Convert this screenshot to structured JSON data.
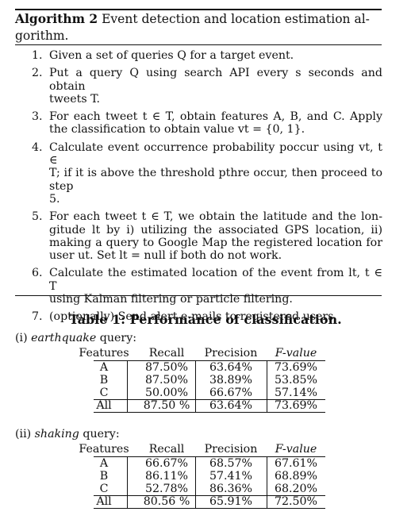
{
  "algorithm": {
    "label": "Algorithm 2",
    "title_line1": "Event detection and location estimation al-",
    "title_line2": "gorithm.",
    "steps": [
      {
        "num": "1.",
        "lines": [
          "Given a set of queries Q for a target event."
        ]
      },
      {
        "num": "2.",
        "lines": [
          "Put a query Q using search API every s seconds and obtain",
          "tweets T."
        ]
      },
      {
        "num": "3.",
        "lines": [
          "For each tweet t ∈ T, obtain features A, B, and C. Apply",
          "the classification to obtain value vt = {0, 1}."
        ]
      },
      {
        "num": "4.",
        "lines": [
          "Calculate event occurrence probability poccur using vt, t ∈",
          "T; if it is above the threshold pthre occur, then proceed to step",
          "5."
        ]
      },
      {
        "num": "5.",
        "lines": [
          "For each tweet t ∈ T, we obtain the latitude and the lon-",
          "gitude lt by i) utilizing the associated GPS location, ii)",
          "making a query to Google Map the registered location for",
          "user ut. Set lt = null if both do not work."
        ]
      },
      {
        "num": "6.",
        "lines": [
          "Calculate the estimated location of the event from lt, t ∈ T",
          "using Kalman filtering or particle filtering."
        ]
      },
      {
        "num": "7.",
        "lines": [
          "(optionally) Send alert e-mails to registered users."
        ]
      }
    ]
  },
  "table": {
    "caption": "Table 1: Performance of classification.",
    "columns": [
      "Features",
      "Recall",
      "Precision",
      "F-value"
    ],
    "queries": [
      {
        "prefix": "(i)",
        "name": "earthquake",
        "suffix": "query:",
        "rows": [
          [
            "A",
            "87.50%",
            "63.64%",
            "73.69%"
          ],
          [
            "B",
            "87.50%",
            "38.89%",
            "53.85%"
          ],
          [
            "C",
            "50.00%",
            "66.67%",
            "57.14%"
          ],
          [
            "All",
            "87.50 %",
            "63.64%",
            "73.69%"
          ]
        ]
      },
      {
        "prefix": "(ii)",
        "name": "shaking",
        "suffix": "query:",
        "rows": [
          [
            "A",
            "66.67%",
            "68.57%",
            "67.61%"
          ],
          [
            "B",
            "86.11%",
            "57.41%",
            "68.89%"
          ],
          [
            "C",
            "52.78%",
            "86.36%",
            "68.20%"
          ],
          [
            "All",
            "80.56 %",
            "65.91%",
            "72.50%"
          ]
        ]
      }
    ]
  }
}
